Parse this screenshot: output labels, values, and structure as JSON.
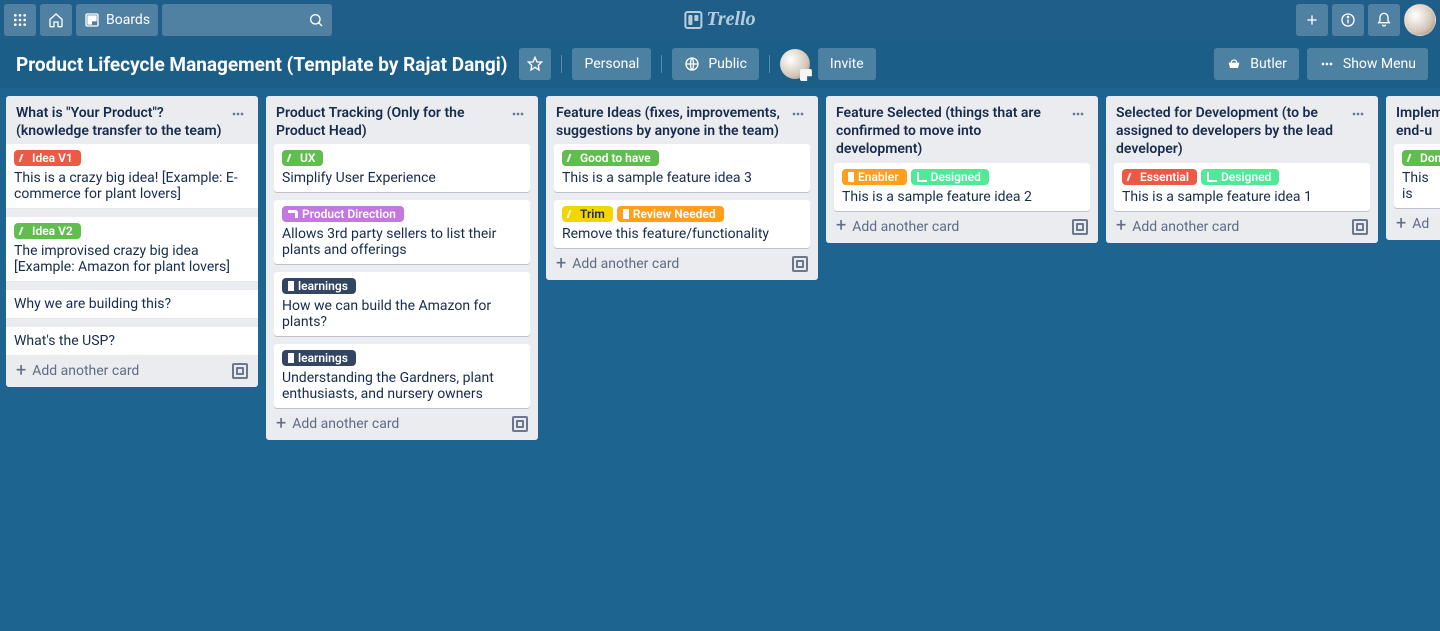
{
  "header": {
    "boards_label": "Boards",
    "logo_text": "Trello"
  },
  "board_bar": {
    "title": "Product Lifecycle Management (Template by Rajat Dangi)",
    "workspace": "Personal",
    "visibility": "Public",
    "invite": "Invite",
    "butler": "Butler",
    "show_menu": "Show Menu"
  },
  "add_card_label": "Add another card",
  "lists": [
    {
      "title": "What is \"Your Product\"? (knowledge transfer to the team)",
      "cards": [
        {
          "labels": [
            {
              "color": "red",
              "text": "Idea V1"
            }
          ],
          "text": "This is a crazy big idea! [Example: E-commerce for plant lovers]"
        },
        {
          "labels": [
            {
              "color": "green",
              "text": "Idea V2"
            }
          ],
          "text": "The improvised crazy big idea [Example: Amazon for plant lovers]"
        },
        {
          "labels": [],
          "text": "Why we are building this?"
        },
        {
          "labels": [],
          "text": "What's the USP?"
        }
      ]
    },
    {
      "title": "Product Tracking (Only for the Product Head)",
      "cards": [
        {
          "labels": [
            {
              "color": "green",
              "text": "UX"
            }
          ],
          "text": "Simplify User Experience"
        },
        {
          "labels": [
            {
              "color": "purple",
              "text": "Product Direction"
            }
          ],
          "text": "Allows 3rd party sellers to list their plants and offerings"
        },
        {
          "labels": [
            {
              "color": "navy",
              "text": "learnings"
            }
          ],
          "text": "How we can build the Amazon for plants?"
        },
        {
          "labels": [
            {
              "color": "navy",
              "text": "learnings"
            }
          ],
          "text": "Understanding the Gardners, plant enthusiasts, and nursery owners"
        }
      ]
    },
    {
      "title": "Feature Ideas (fixes, improvements, suggestions by anyone in the team)",
      "cards": [
        {
          "labels": [
            {
              "color": "green",
              "text": "Good to have"
            }
          ],
          "text": "This is a sample feature idea 3"
        },
        {
          "labels": [
            {
              "color": "yellow",
              "text": "Trim"
            },
            {
              "color": "orange",
              "text": "Review Needed"
            }
          ],
          "text": "Remove this feature/functionality"
        }
      ]
    },
    {
      "title": "Feature Selected (things that are confirmed to move into development)",
      "cards": [
        {
          "labels": [
            {
              "color": "orange",
              "text": "Enabler"
            },
            {
              "color": "designed",
              "text": "Designed"
            }
          ],
          "text": "This is a sample feature idea 2"
        }
      ]
    },
    {
      "title": "Selected for Development (to be assigned to developers by the lead developer)",
      "cards": [
        {
          "labels": [
            {
              "color": "red",
              "text": "Essential"
            },
            {
              "color": "designed",
              "text": "Designed"
            }
          ],
          "text": "This is a sample feature idea 1"
        }
      ]
    },
    {
      "title": "Implemented end-u",
      "partial": true,
      "cards": [
        {
          "labels": [
            {
              "color": "green",
              "text": "Don"
            }
          ],
          "text": "This is"
        }
      ]
    }
  ]
}
